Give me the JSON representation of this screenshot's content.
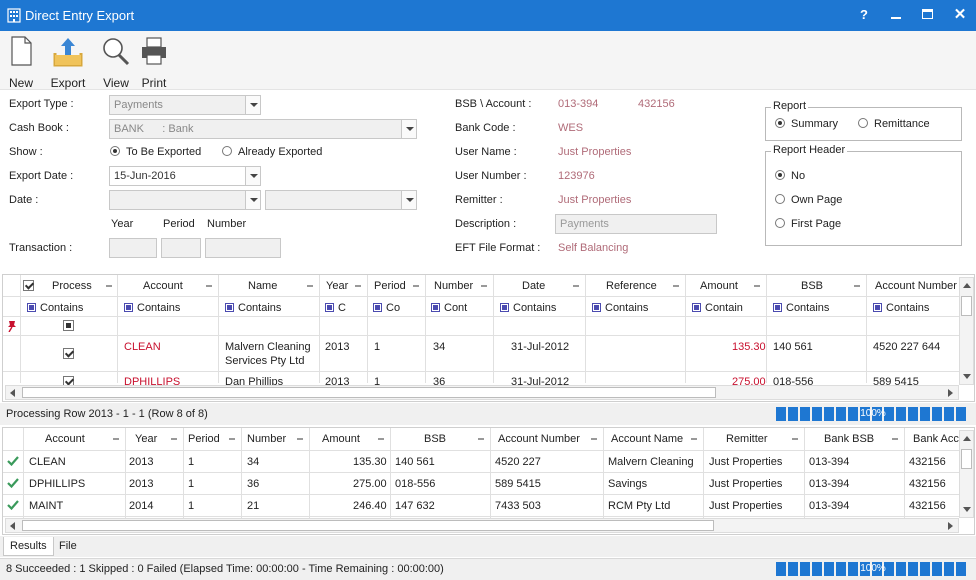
{
  "window": {
    "title": "Direct Entry Export"
  },
  "toolbar": {
    "new_label": "New",
    "export_label": "Export",
    "view_label": "View",
    "print_label": "Print"
  },
  "form": {
    "export_type_label": "Export Type :",
    "export_type_value": "Payments",
    "cash_book_label": "Cash Book :",
    "cash_book_value": "BANK      : Bank",
    "show_label": "Show :",
    "show_opt1": "To Be Exported",
    "show_opt2": "Already Exported",
    "export_date_label": "Export Date :",
    "export_date_value": "15-Jun-2016",
    "date_label": "Date :",
    "year_label": "Year",
    "period_label": "Period",
    "number_label": "Number",
    "transaction_label": "Transaction :",
    "bsb_account_label": "BSB \\ Account :",
    "bsb_value": "013-394",
    "account_value": "432156",
    "bank_code_label": "Bank Code :",
    "bank_code_value": "WES",
    "user_name_label": "User Name :",
    "user_name_value": "Just Properties",
    "user_number_label": "User Number :",
    "user_number_value": "123976",
    "remitter_label": "Remitter :",
    "remitter_value": "Just Properties",
    "description_label": "Description :",
    "description_value": "Payments",
    "eft_label": "EFT File Format :",
    "eft_value": "Self Balancing"
  },
  "report": {
    "group_label": "Report",
    "opt_summary": "Summary",
    "opt_remittance": "Remittance",
    "header_group_label": "Report Header",
    "opt_no": "No",
    "opt_own_page": "Own Page",
    "opt_first_page": "First Page"
  },
  "grid1": {
    "headers": [
      "Process",
      "Account",
      "Name",
      "Year",
      "Period",
      "Number",
      "Date",
      "Reference",
      "Amount",
      "BSB",
      "Account Number"
    ],
    "filters": [
      "Contains",
      "Contains",
      "Contains",
      "C",
      "Co",
      "Cont",
      "Contains",
      "Contains",
      "Contain",
      "Contains",
      "Contains"
    ],
    "rows": [
      {
        "account": "CLEAN",
        "name1": "Malvern Cleaning",
        "name2": "Services Pty Ltd",
        "year": "2013",
        "period": "1",
        "number": "34",
        "date": "31-Jul-2012",
        "amount": "135.30",
        "bsb": "140 561",
        "acct_no": "4520 227 644"
      },
      {
        "account": "DPHILLIPS",
        "name1": "Dan Phillips",
        "year": "2013",
        "period": "1",
        "number": "36",
        "date": "31-Jul-2012",
        "amount": "275.00",
        "bsb": "018-556",
        "acct_no": "589 5415"
      }
    ]
  },
  "processing": {
    "text": "Processing Row 2013 - 1 - 1 (Row 8 of 8)",
    "percent": "100%"
  },
  "grid2": {
    "headers": [
      "Account",
      "Year",
      "Period",
      "Number",
      "Amount",
      "BSB",
      "Account Number",
      "Account Name",
      "Remitter",
      "Bank BSB",
      "Bank Acc"
    ],
    "rows": [
      [
        "CLEAN",
        "2013",
        "1",
        "34",
        "135.30",
        "140 561",
        "4520 227",
        "Malvern Cleaning",
        "Just Properties",
        "013-394",
        "432156"
      ],
      [
        "DPHILLIPS",
        "2013",
        "1",
        "36",
        "275.00",
        "018-556",
        "589 5415",
        "Savings",
        "Just Properties",
        "013-394",
        "432156"
      ],
      [
        "MAINT",
        "2014",
        "1",
        "21",
        "246.40",
        "147 632",
        "7433 503",
        "RCM Pty Ltd",
        "Just Properties",
        "013-394",
        "432156"
      ]
    ]
  },
  "tabs": {
    "results": "Results",
    "file": "File"
  },
  "status": {
    "text": "8 Succeeded : 1 Skipped : 0 Failed  (Elapsed Time: 00:00:00 - Time Remaining : 00:00:00)",
    "percent": "100%"
  },
  "colors": {
    "titlebar": "#1e77d2",
    "accent_red": "#c8102e",
    "value_text": "#b06b78"
  }
}
